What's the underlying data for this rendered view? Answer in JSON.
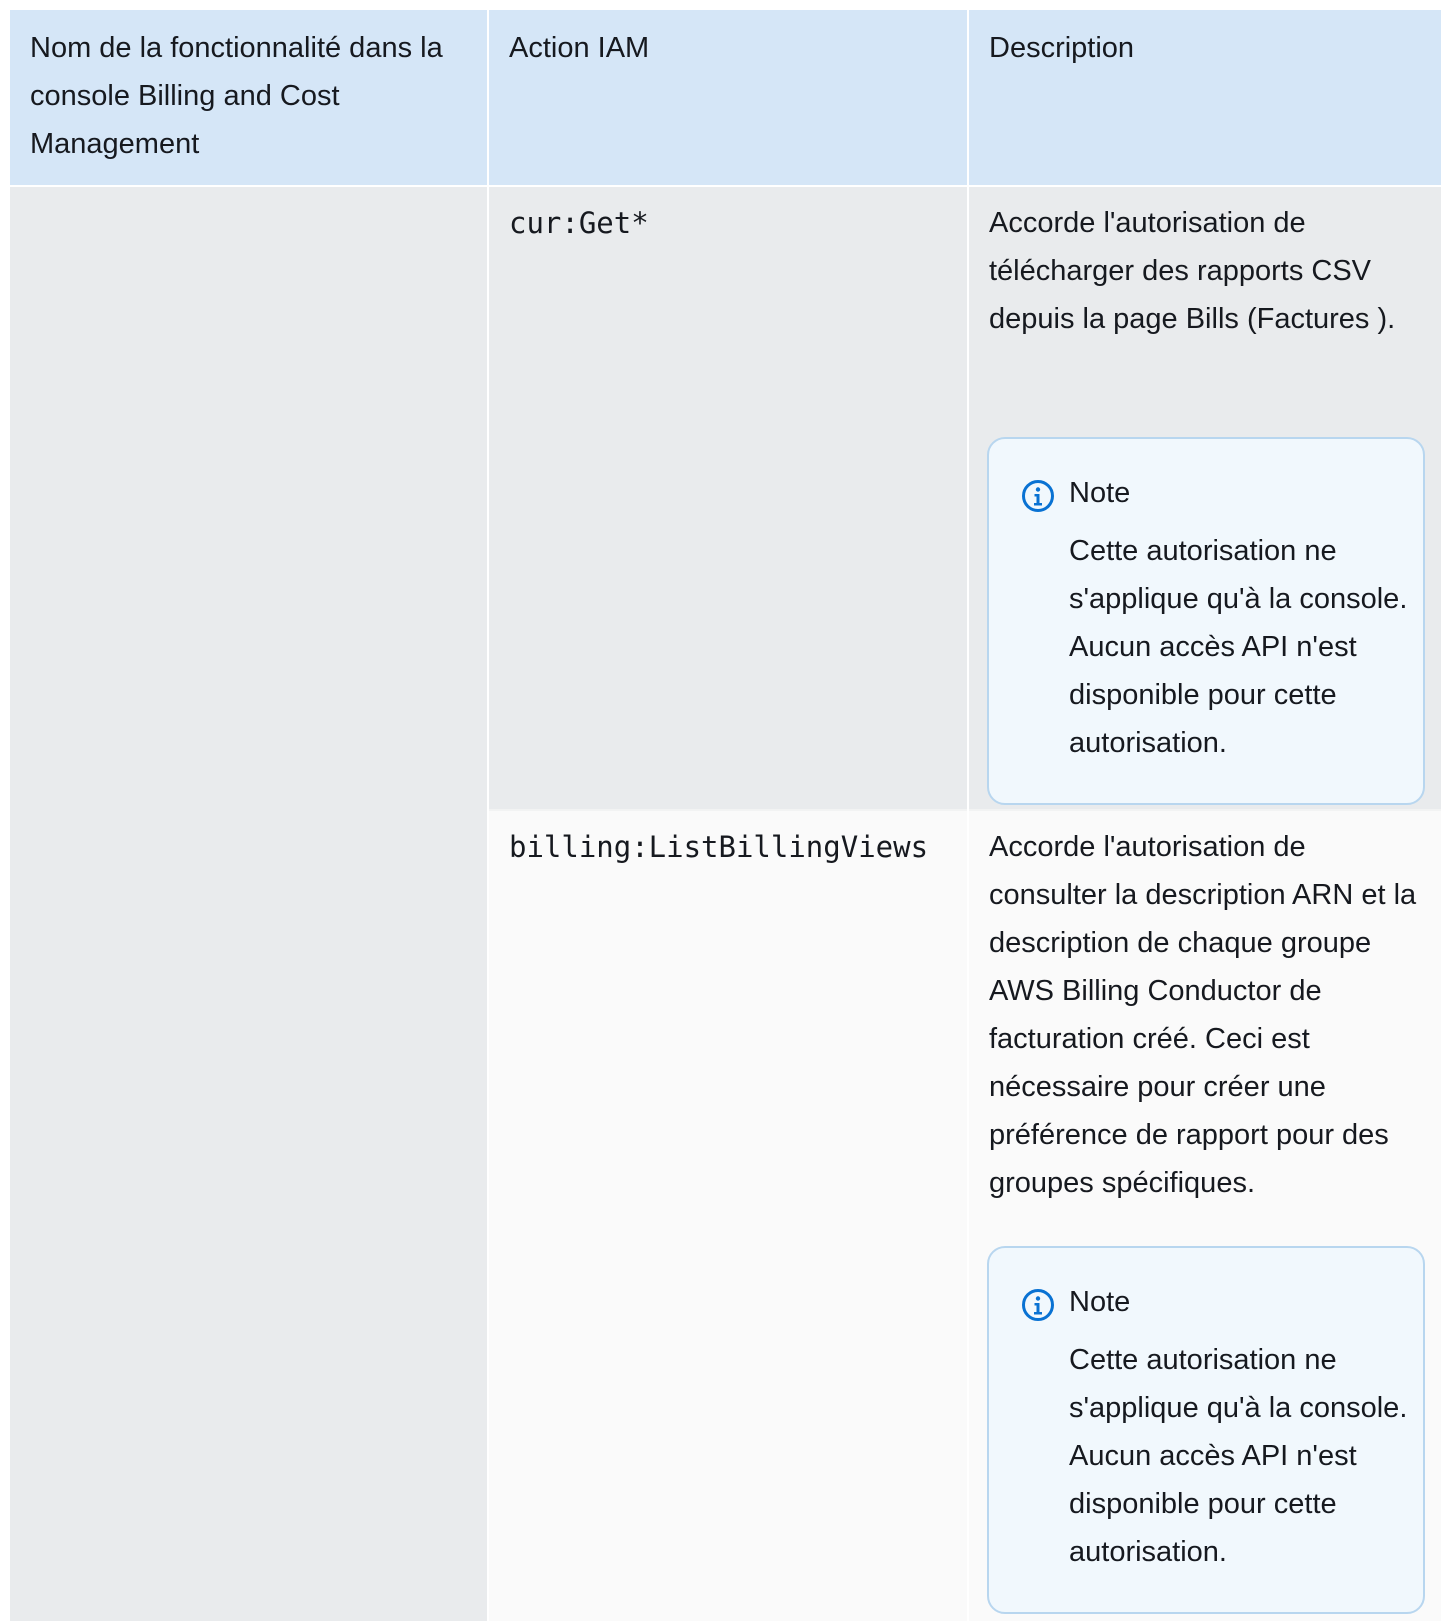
{
  "table": {
    "headers": [
      "Nom de la fonctionnalité dans la console Billing and Cost Management",
      "Action IAM",
      "Description"
    ],
    "rows": [
      {
        "feature": "",
        "action": "cur:Get*",
        "description": "Accorde l'autorisation de télécharger des rapports CSV depuis la page Bills (Factures ).",
        "note": {
          "title": "Note",
          "body": "Cette autorisation ne s'applique qu'à la console. Aucun accès API n'est disponible pour cette autorisation."
        }
      },
      {
        "feature": "",
        "action": "billing:ListBillingViews",
        "description": "Accorde l'autorisation de consulter la description ARN et la description de chaque groupe AWS Billing Conductor de facturation créé. Ceci est nécessaire pour créer une préférence de rapport pour des groupes spécifiques.",
        "note": {
          "title": "Note",
          "body": "Cette autorisation ne s'applique qu'à la console. Aucun accès API n'est disponible pour cette autorisation."
        }
      }
    ]
  },
  "colors": {
    "header_bg": "#d5e6f7",
    "row_shaded_bg": "#e9ebed",
    "row_light_bg": "#fafafa",
    "note_bg": "#f1f8fd",
    "note_border": "#b8d6ef",
    "info_icon": "#0972d3"
  },
  "icons": {
    "note_icon": "info-circle-icon"
  }
}
